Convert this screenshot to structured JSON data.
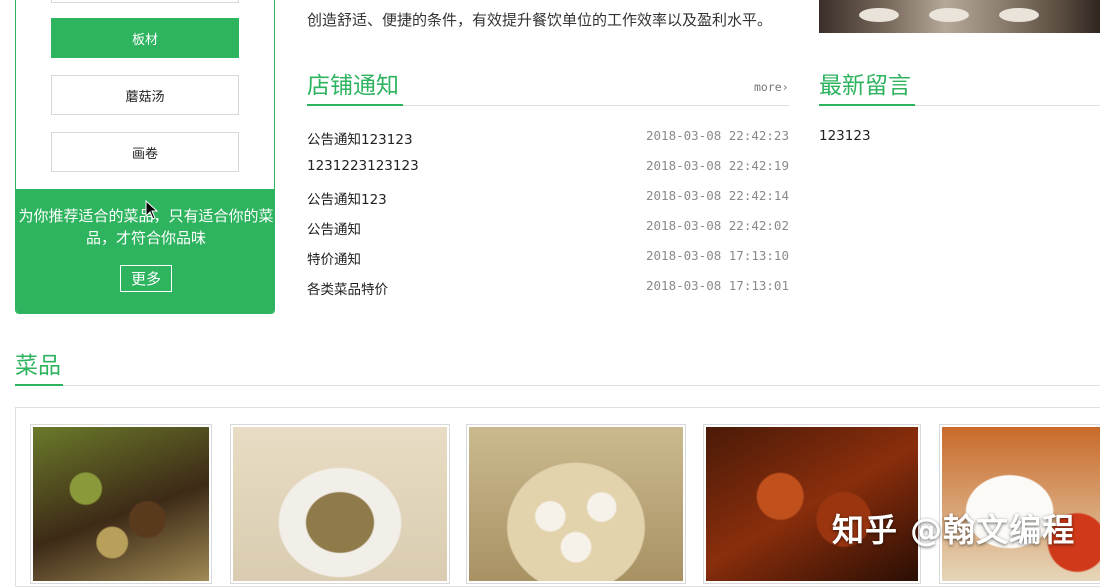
{
  "categories": [
    {
      "label": "板材",
      "active": true
    },
    {
      "label": "蘑菇汤",
      "active": false
    },
    {
      "label": "画卷",
      "active": false
    }
  ],
  "promo": {
    "text": "为你推荐适合的菜品，只有适合你的菜品，才符合你品味",
    "more_label": "更多"
  },
  "intro_text": "创造舒适、便捷的条件，有效提升餐饮单位的工作效率以及盈利水平。",
  "notices": {
    "title": "店铺通知",
    "more_label": "more",
    "items": [
      {
        "title": "公告通知123123",
        "date": "2018-03-08 22:42:23"
      },
      {
        "title": "1231223123123",
        "date": "2018-03-08 22:42:19"
      },
      {
        "title": "公告通知123",
        "date": "2018-03-08 22:42:14"
      },
      {
        "title": "公告通知",
        "date": "2018-03-08 22:42:02"
      },
      {
        "title": "特价通知",
        "date": "2018-03-08 17:13:10"
      },
      {
        "title": "各类菜品特价",
        "date": "2018-03-08 17:13:01"
      }
    ]
  },
  "messages": {
    "title": "最新留言",
    "items": [
      {
        "text": "123123"
      }
    ]
  },
  "dishes": {
    "title": "菜品",
    "items": [
      {
        "image": "stir-fried-vegetables"
      },
      {
        "image": "soup-pot"
      },
      {
        "image": "steamed-buns"
      },
      {
        "image": "braised-ribs"
      },
      {
        "image": "rice-plate"
      }
    ]
  },
  "watermark": "知乎 @翰文编程",
  "colors": {
    "accent": "#2eb35f",
    "date_text": "#8a8a8a",
    "border": "#e0e0e0"
  }
}
